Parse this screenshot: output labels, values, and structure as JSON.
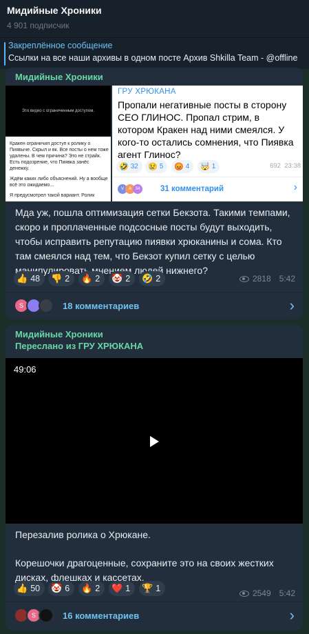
{
  "channel": {
    "title": "Мидийные Хроники",
    "subscribers": "4 901 подписчик"
  },
  "pinned": {
    "title": "Закреплённое сообщение",
    "text": "Ссылки на все наши архивы в одном посте  Архив Shkilla Team - @offline"
  },
  "post1": {
    "author": "Мидийные Хроники",
    "thumb_left": {
      "video_caption": "Это видео с ограниченным доступом.",
      "paragraphs": [
        "Кракен ограничил доступ к ролику о Пиявыче. Скрыл и вк. Все посты о нем тоже удалены. В чем причина? Это не страйк. Есть подозрение, что Пиявка занёс денежку.",
        "Ждём каких либо объяснений. Ну а вообще всё это ожидаемо...",
        "Я предусмотрел такой вариант. Ролик"
      ]
    },
    "quote": {
      "author": "ГРУ ХРЮКАНА",
      "text": "Пропали негативные посты в сторону СЕО ГЛИНОС. Пропал стрим, в котором Кракен над ними смеялся. У кого-то остались сомнения, что Пиявка агент Глинос?",
      "reactions": [
        {
          "emoji": "🤣",
          "count": "32"
        },
        {
          "emoji": "😢",
          "count": "5"
        },
        {
          "emoji": "😡",
          "count": "4"
        },
        {
          "emoji": "🤯",
          "count": "1"
        }
      ],
      "views": "692",
      "time": "23:38",
      "avatars": [
        {
          "letter": "V",
          "color": "#7b8ee6"
        },
        {
          "letter": "A",
          "color": "#f59a5a"
        },
        {
          "letter": "34",
          "color": "#b980e8"
        }
      ],
      "comments_label": "31 комментарий"
    },
    "text": "Мда уж, пошла оптимизация сетки Бекзота. Такими темпами, скоро и проплаченные подсосные посты будут выходить, чтобы исправить репутацию пиявки хрюканины и сома. Кто там смеялся над тем, что Бекзот купил сетку с целью манипулировать мнением людей нижнего?",
    "reactions": [
      {
        "emoji": "👍",
        "count": "48"
      },
      {
        "emoji": "👎",
        "count": "2"
      },
      {
        "emoji": "🔥",
        "count": "2"
      },
      {
        "emoji": "🤡",
        "count": "2"
      },
      {
        "emoji": "🤣",
        "count": "2"
      }
    ],
    "views": "2818",
    "time": "5:42",
    "avatars": [
      {
        "letter": "S",
        "color": "#e56a8a"
      },
      {
        "letter": "",
        "color": "#8b7cf0"
      },
      {
        "letter": "",
        "color": "#3a3f47"
      }
    ],
    "comments_label": "18 комментариев"
  },
  "post2": {
    "author": "Мидийные Хроники",
    "forwarded": "Переслано из ГРУ ХРЮКАНА",
    "video_duration": "49:06",
    "text_line1": "Перезалив ролика о Хрюкане.",
    "text_line2": "Корешочки драгоценные, сохраните это на своих жестких дисках, флешках и кассетах.",
    "reactions": [
      {
        "emoji": "👍",
        "count": "50"
      },
      {
        "emoji": "🤡",
        "count": "6"
      },
      {
        "emoji": "🔥",
        "count": "2"
      },
      {
        "emoji": "❤️",
        "count": "1"
      },
      {
        "emoji": "🏆",
        "count": "1"
      }
    ],
    "views": "2549",
    "time": "5:42",
    "avatars": [
      {
        "letter": "",
        "color": "#8a2e2e"
      },
      {
        "letter": "S",
        "color": "#e56a8a"
      },
      {
        "letter": "",
        "color": "#111111"
      }
    ],
    "comments_label": "16 комментариев"
  }
}
